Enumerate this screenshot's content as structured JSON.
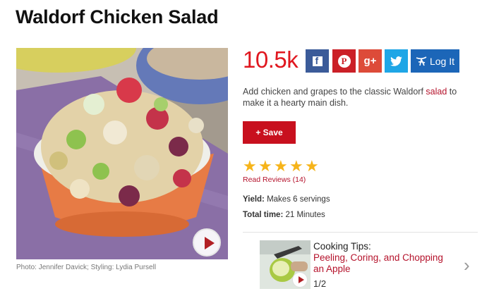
{
  "recipe": {
    "title": "Waldorf Chicken Salad",
    "photo_credit": "Photo: Jennifer Davick; Styling: Lydia Pursell",
    "description_before": "Add chicken and grapes to the classic Waldorf ",
    "description_link": "salad",
    "description_after": " to make it a hearty main dish.",
    "save_label": "+ Save",
    "rating": 5,
    "rating_stars": "★★★★★",
    "reviews_label": "Read Reviews (14)",
    "yield_label": "Yield:",
    "yield_value": " Makes 6 servings",
    "time_label": "Total time:",
    "time_value": " 21 Minutes"
  },
  "share": {
    "count": "10.5k",
    "buttons": [
      {
        "network": "facebook",
        "icon": "facebook-icon",
        "color": "#3b5b99"
      },
      {
        "network": "pinterest",
        "icon": "pinterest-icon",
        "glyph": "P",
        "color": "#cb2027"
      },
      {
        "network": "google-plus",
        "icon": "google-plus-icon",
        "glyph": "g+",
        "color": "#dd4b39"
      },
      {
        "network": "twitter",
        "icon": "twitter-bird-icon",
        "color": "#1fa6e6"
      }
    ],
    "login_label": "Log It",
    "login_color": "#1c66b8"
  },
  "cooking_tip": {
    "heading": "Cooking Tips:",
    "title": "Peeling, Coring, and Chopping an Apple",
    "page": "1/2",
    "next_glyph": "›"
  },
  "colors": {
    "accent_red": "#e0171f",
    "button_red": "#c8101e",
    "link_red": "#b5122b",
    "star_gold": "#f6b41a"
  }
}
